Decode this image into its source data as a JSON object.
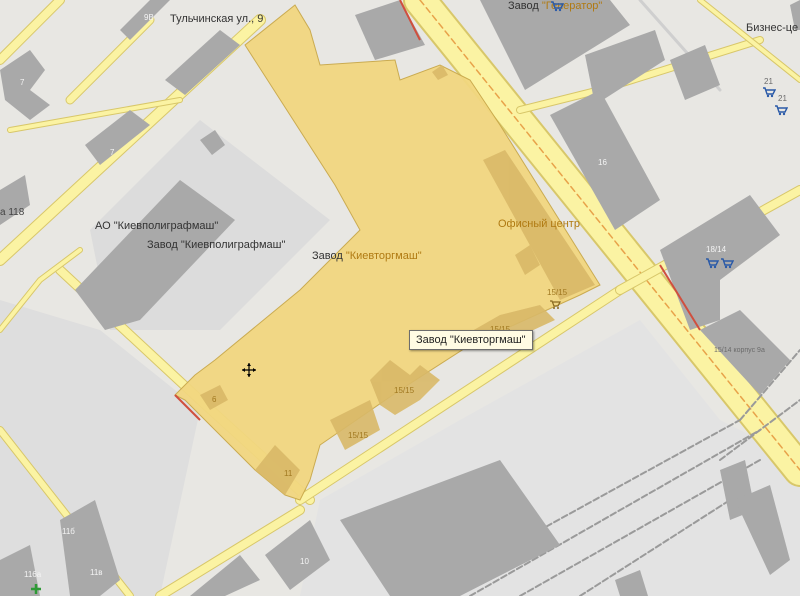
{
  "map": {
    "street_labels": {
      "tulchynska": "Тульчинская ул., 9",
      "business_center": "Бизнес-це"
    },
    "poi_labels": {
      "zavod_generator_prefix": "Завод ",
      "zavod_generator_name": "\"Генератор\"",
      "ao_kievpoligrafmash": "АО \"Киевполиграфмаш\"",
      "zavod_kievpoligrafmash": "Завод \"Киевполиграфмаш\"",
      "zavod_kievtorgmash_prefix": "Завод ",
      "zavod_kievtorgmash_name": "\"Киевторгмаш\"",
      "office_center": "Офисный центр"
    },
    "house_numbers": {
      "n9b": "9В",
      "n7a": "7",
      "n7b": "7",
      "n118": "а 118",
      "n16": "16",
      "n21a": "21",
      "n21b": "21",
      "n18_14": "18/14",
      "n15_14": "15/14 корпус 9а",
      "n15_15a": "15/15",
      "n15_15b": "15/15",
      "n15_15c": "15/15",
      "n15_15d": "15/15",
      "n6": "6",
      "n11": "11",
      "n11b": "11б",
      "n11a": "116а",
      "n11v": "11в",
      "n10": "10"
    },
    "tooltip": "Завод \"Киевторгмаш\""
  },
  "icons": {
    "shop_icon": "shopping-cart-icon",
    "cursor_icon": "move-cursor-icon"
  },
  "colors": {
    "road_fill": "#fbf3a3",
    "road_edge": "#d8c76a",
    "building": "#a9a9a9",
    "highlight": "#f2d780",
    "highlight_border": "#c9a84a"
  }
}
